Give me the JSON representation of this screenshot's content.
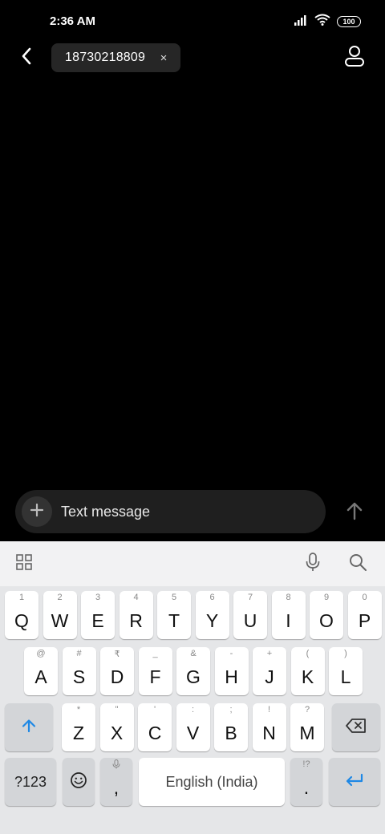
{
  "status_bar": {
    "time": "2:36 AM",
    "battery": "100",
    "icons": [
      "signal-icon",
      "wifi-icon",
      "battery-icon"
    ]
  },
  "header": {
    "recipient": "18730218809",
    "chip_remove_glyph": "×",
    "icons": [
      "back-arrow-icon",
      "close-icon",
      "contact-icon"
    ]
  },
  "composer": {
    "placeholder": "Text message",
    "value": "",
    "attach_glyph": "+",
    "icons": [
      "plus-icon",
      "send-arrow-icon"
    ]
  },
  "keyboard": {
    "toolbar_icons": [
      "apps-grid-icon",
      "microphone-icon",
      "search-icon"
    ],
    "row1": [
      {
        "key": "Q",
        "hint": "1"
      },
      {
        "key": "W",
        "hint": "2"
      },
      {
        "key": "E",
        "hint": "3"
      },
      {
        "key": "R",
        "hint": "4"
      },
      {
        "key": "T",
        "hint": "5"
      },
      {
        "key": "Y",
        "hint": "6"
      },
      {
        "key": "U",
        "hint": "7"
      },
      {
        "key": "I",
        "hint": "8"
      },
      {
        "key": "O",
        "hint": "9"
      },
      {
        "key": "P",
        "hint": "0"
      }
    ],
    "row2": [
      {
        "key": "A",
        "hint": "@"
      },
      {
        "key": "S",
        "hint": "#"
      },
      {
        "key": "D",
        "hint": "₹"
      },
      {
        "key": "F",
        "hint": "_"
      },
      {
        "key": "G",
        "hint": "&"
      },
      {
        "key": "H",
        "hint": "-"
      },
      {
        "key": "J",
        "hint": "+"
      },
      {
        "key": "K",
        "hint": "("
      },
      {
        "key": "L",
        "hint": ")"
      }
    ],
    "row3": [
      {
        "key": "Z",
        "hint": "*"
      },
      {
        "key": "X",
        "hint": "\""
      },
      {
        "key": "C",
        "hint": "'"
      },
      {
        "key": "V",
        "hint": ":"
      },
      {
        "key": "B",
        "hint": ";"
      },
      {
        "key": "N",
        "hint": "!"
      },
      {
        "key": "M",
        "hint": "?"
      }
    ],
    "symbols_label": "?123",
    "comma_label": ",",
    "space_label": "English (India)",
    "period_label": ".",
    "period_hint": "!?",
    "icons": [
      "shift-icon",
      "backspace-icon",
      "emoji-icon",
      "enter-icon"
    ],
    "accent_color": "#1e88e5"
  }
}
